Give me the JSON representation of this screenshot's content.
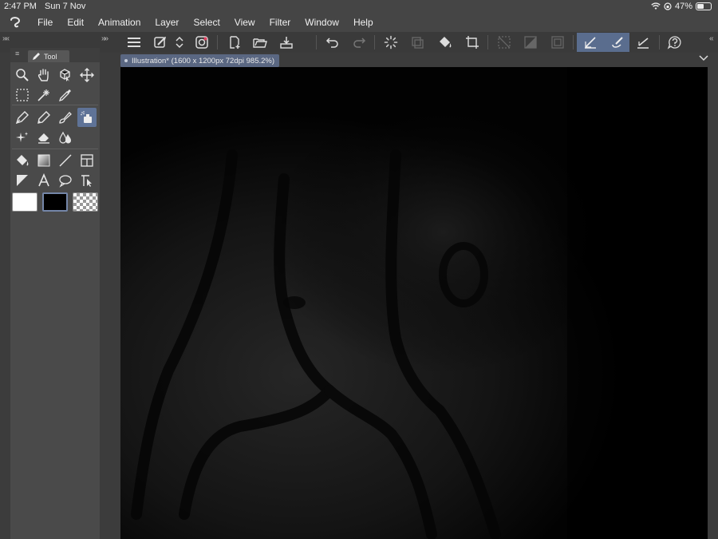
{
  "status_bar": {
    "time": "2:47 PM",
    "date": "Sun 7 Nov",
    "battery": "47%"
  },
  "menu": {
    "items": [
      "File",
      "Edit",
      "Animation",
      "Layer",
      "Select",
      "View",
      "Filter",
      "Window",
      "Help"
    ]
  },
  "tool_panel": {
    "tab_label": "Tool"
  },
  "document": {
    "tab_label": "Illustration* (1600 x 1200px 72dpi 985.2%)"
  },
  "colors": {
    "accent": "#5f7397",
    "canvas_background": "#000000",
    "ui_background": "#3c3c3c"
  }
}
